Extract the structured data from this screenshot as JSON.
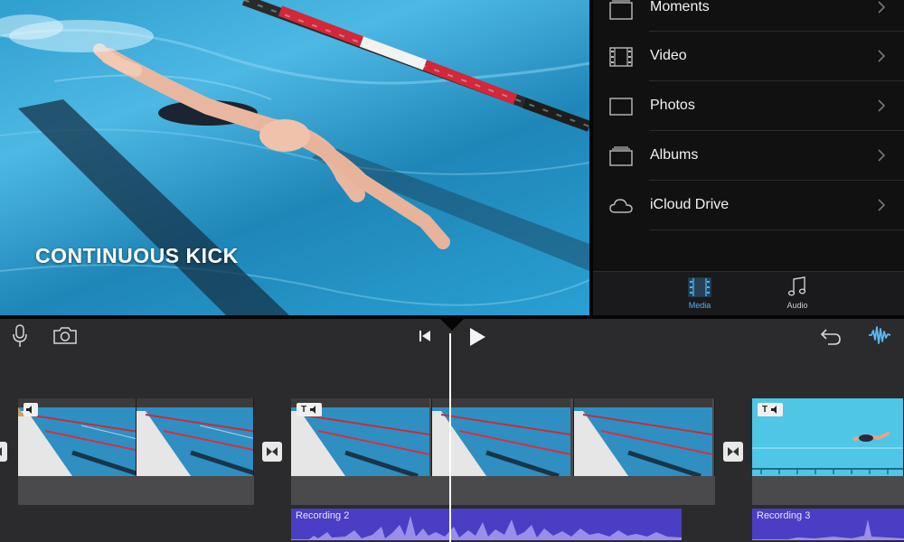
{
  "viewer": {
    "title_overlay": "CONTINUOUS KICK"
  },
  "media_browser": {
    "items": [
      {
        "label": "Moments",
        "icon": "moments-icon"
      },
      {
        "label": "Video",
        "icon": "film-icon"
      },
      {
        "label": "Photos",
        "icon": "photo-icon"
      },
      {
        "label": "Albums",
        "icon": "albums-icon"
      },
      {
        "label": "iCloud Drive",
        "icon": "cloud-icon"
      }
    ],
    "tabs": [
      {
        "label": "Media",
        "icon": "film-icon",
        "selected": true
      },
      {
        "label": "Audio",
        "icon": "music-note-icon",
        "selected": false
      }
    ],
    "accent_color": "#4cb4ff"
  },
  "toolbar": {
    "left": [
      "microphone-icon",
      "camera-icon"
    ],
    "center": [
      "skip-to-start-icon",
      "play-icon"
    ],
    "right": [
      "undo-icon",
      "audio-waveform-icon"
    ],
    "waveform_color": "#5ab8ff"
  },
  "timeline": {
    "clips": [
      {
        "badges": [
          "speaker-muted"
        ]
      },
      {
        "badges": [
          "T",
          "speaker-muted"
        ]
      },
      {
        "badges": [
          "T",
          "speaker-muted"
        ]
      }
    ],
    "audio_clips": [
      {
        "label": "Recording 2"
      },
      {
        "label": "Recording 3"
      }
    ],
    "audio_color": "#4a3ec4"
  }
}
